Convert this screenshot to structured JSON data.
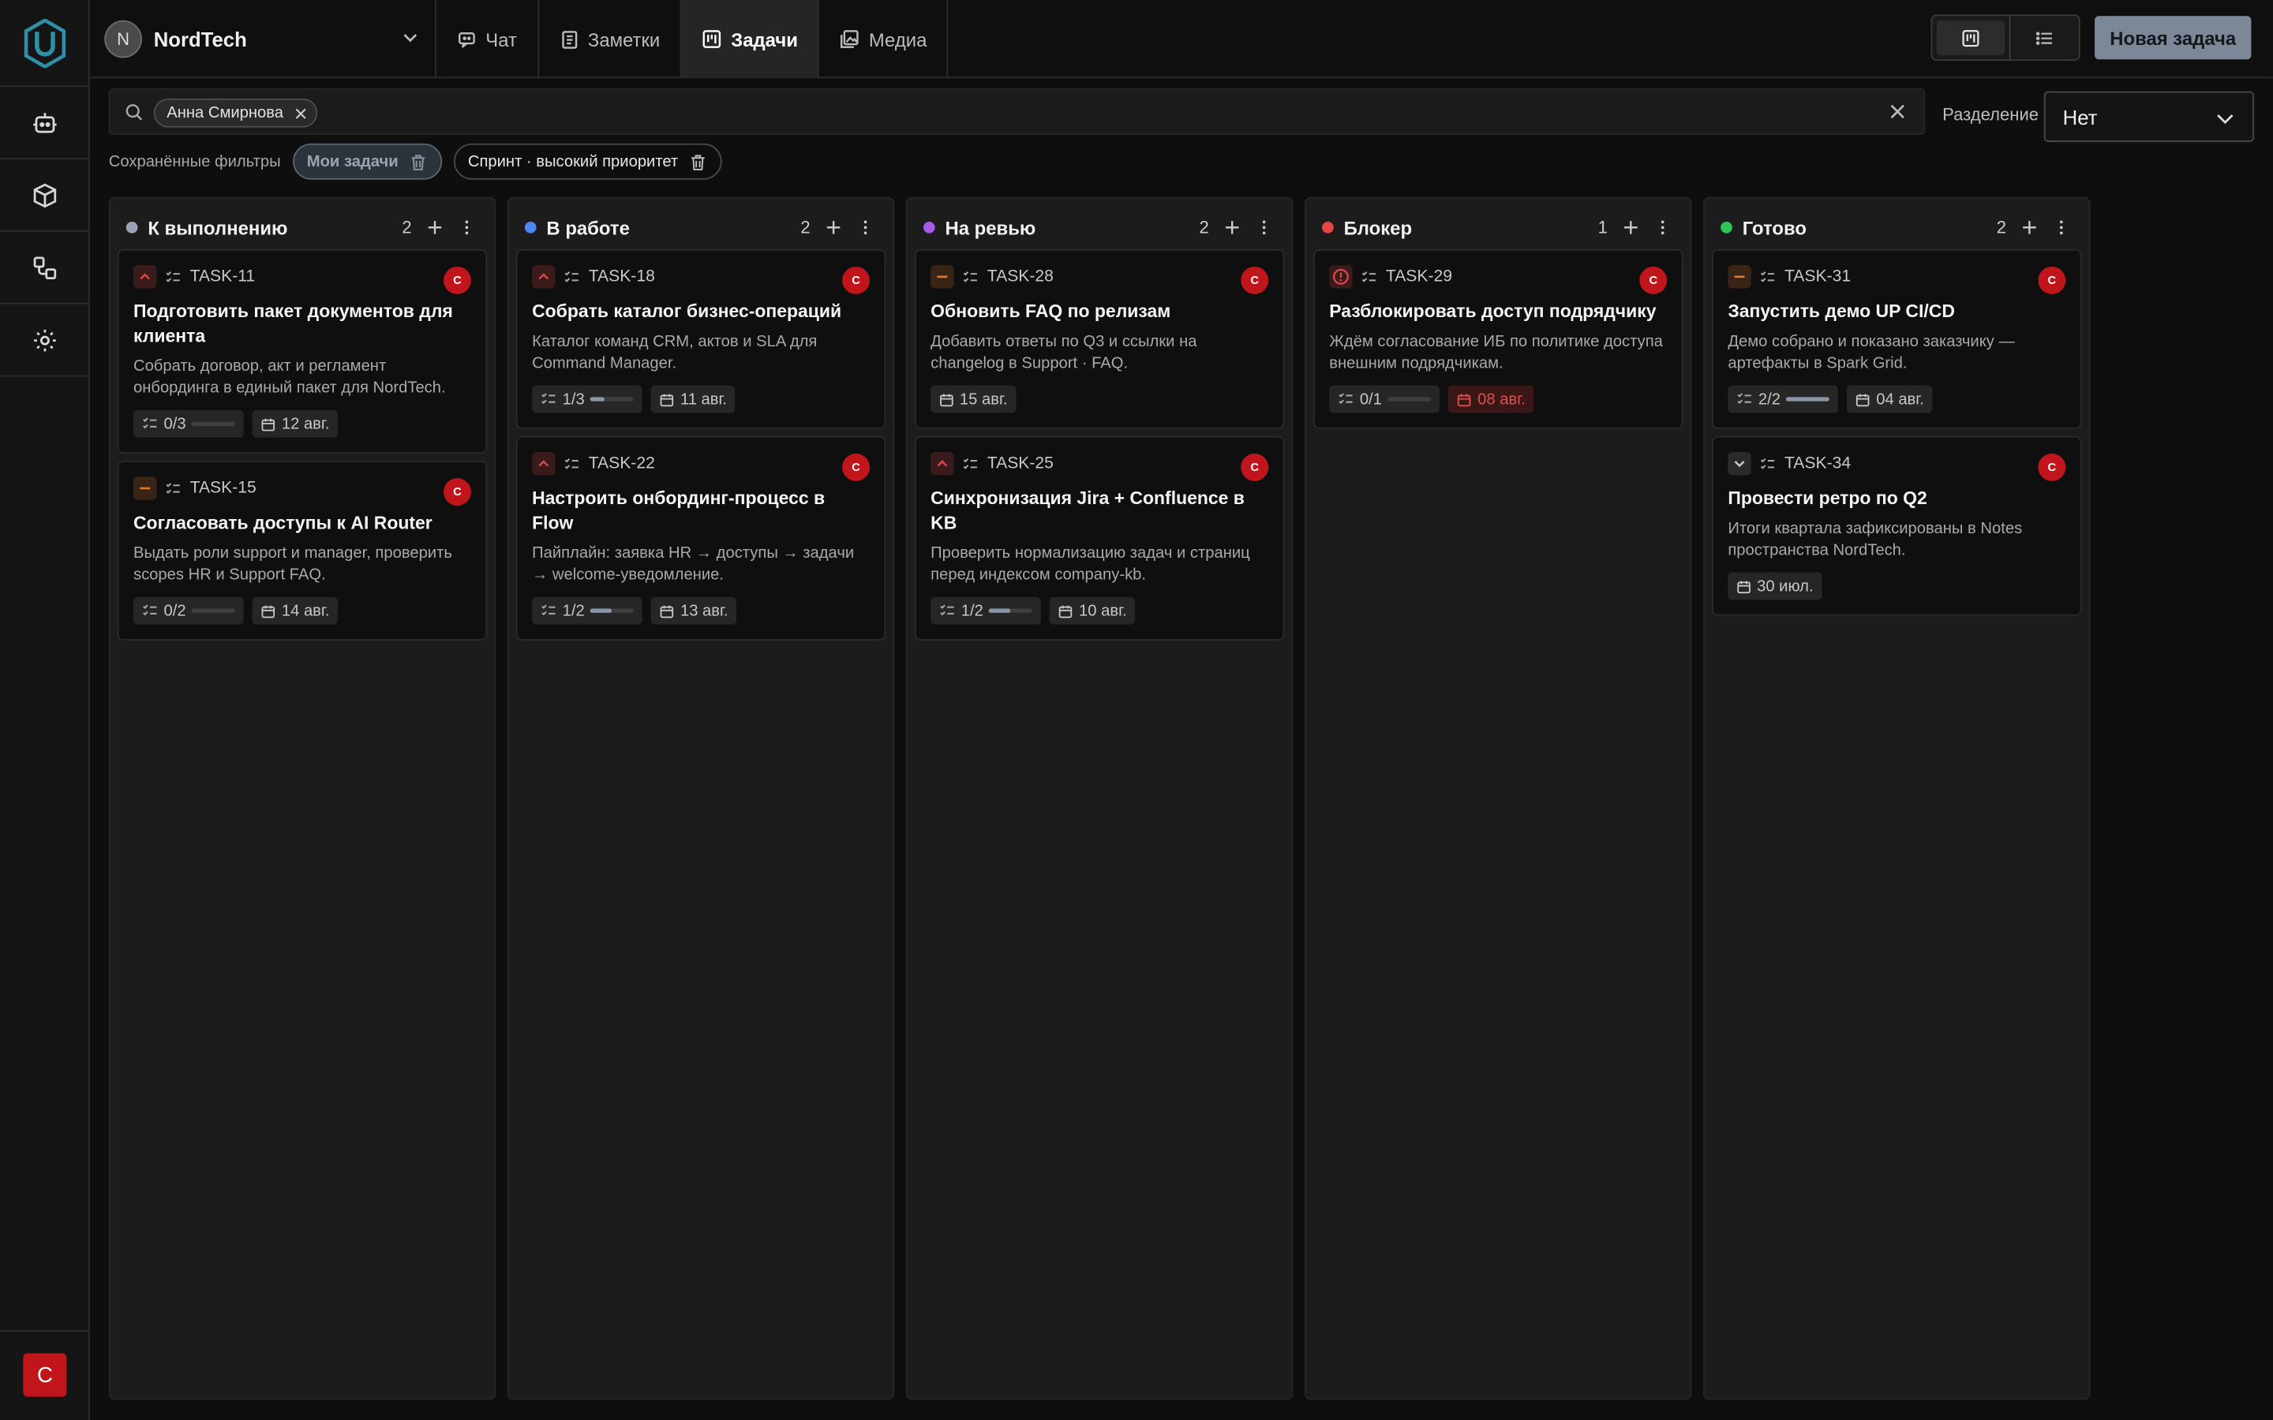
{
  "workspace": {
    "initial": "N",
    "name": "NordTech"
  },
  "nav": {
    "tabs": [
      {
        "label": "Чат",
        "icon": "chat-icon"
      },
      {
        "label": "Заметки",
        "icon": "notes-icon"
      },
      {
        "label": "Задачи",
        "icon": "board-icon",
        "active": true
      },
      {
        "label": "Медиа",
        "icon": "media-icon"
      }
    ]
  },
  "header": {
    "new_task": "Новая задача",
    "view": "board"
  },
  "user": {
    "initial": "C"
  },
  "search": {
    "chip": "Анна Смирнова"
  },
  "split": {
    "label": "Разделение",
    "value": "Нет"
  },
  "saved_filters": {
    "label": "Сохранённые фильтры",
    "items": [
      {
        "label": "Мои задачи",
        "active": true
      },
      {
        "label": "Спринт · высокий приоритет",
        "active": false
      }
    ]
  },
  "columns": [
    {
      "title": "К выполнению",
      "count": "2",
      "color": "#9aa3b5",
      "cards": [
        {
          "id": "TASK-11",
          "priority": "high",
          "title": "Подготовить пакет документов для клиента",
          "desc": "Собрать договор, акт и регламент онбординга в единый пакет для NordTech.",
          "progress": "0/3",
          "progress_frac": 0,
          "date": "12 авг.",
          "overdue": false,
          "assignee": "C"
        },
        {
          "id": "TASK-15",
          "priority": "medium",
          "title": "Согласовать доступы к AI Router",
          "desc": "Выдать роли support и manager, проверить scopes HR и Support FAQ.",
          "progress": "0/2",
          "progress_frac": 0,
          "date": "14 авг.",
          "overdue": false,
          "assignee": "C"
        }
      ]
    },
    {
      "title": "В работе",
      "count": "2",
      "color": "#4e86f0",
      "cards": [
        {
          "id": "TASK-18",
          "priority": "high",
          "title": "Собрать каталог бизнес-операций",
          "desc": "Каталог команд CRM, актов и SLA для Command Manager.",
          "progress": "1/3",
          "progress_frac": 0.333,
          "date": "11 авг.",
          "overdue": false,
          "assignee": "C"
        },
        {
          "id": "TASK-22",
          "priority": "high",
          "title": "Настроить онбординг-процесс в Flow",
          "desc": "Пайплайн: заявка HR → доступы → задачи → welcome-уведомление.",
          "progress": "1/2",
          "progress_frac": 0.5,
          "date": "13 авг.",
          "overdue": false,
          "assignee": "C"
        }
      ]
    },
    {
      "title": "На ревью",
      "count": "2",
      "color": "#a45be6",
      "cards": [
        {
          "id": "TASK-28",
          "priority": "medium",
          "title": "Обновить FAQ по релизам",
          "desc": "Добавить ответы по Q3 и ссылки на changelog в Support · FAQ.",
          "progress": "",
          "progress_frac": null,
          "date": "15 авг.",
          "overdue": false,
          "assignee": "C"
        },
        {
          "id": "TASK-25",
          "priority": "high",
          "title": "Синхронизация Jira + Confluence в KB",
          "desc": "Проверить нормализацию задач и страниц перед индексом company-kb.",
          "progress": "1/2",
          "progress_frac": 0.5,
          "date": "10 авг.",
          "overdue": false,
          "assignee": "C"
        }
      ]
    },
    {
      "title": "Блокер",
      "count": "1",
      "color": "#e54545",
      "cards": [
        {
          "id": "TASK-29",
          "priority": "urgent",
          "title": "Разблокировать доступ подрядчику",
          "desc": "Ждём согласование ИБ по политике доступа внешним подрядчикам.",
          "progress": "0/1",
          "progress_frac": 0,
          "date": "08 авг.",
          "overdue": true,
          "assignee": "C"
        }
      ]
    },
    {
      "title": "Готово",
      "count": "2",
      "color": "#2fc35a",
      "cards": [
        {
          "id": "TASK-31",
          "priority": "medium",
          "title": "Запустить демо UP CI/CD",
          "desc": "Демо собрано и показано заказчику — артефакты в Spark Grid.",
          "progress": "2/2",
          "progress_frac": 1,
          "date": "04 авг.",
          "overdue": false,
          "assignee": "C"
        },
        {
          "id": "TASK-34",
          "priority": "low",
          "title": "Провести ретро по Q2",
          "desc": "Итоги квартала зафиксированы в Notes пространства NordTech.",
          "progress": "",
          "progress_frac": null,
          "date": "30 июл.",
          "overdue": false,
          "assignee": "C"
        }
      ]
    }
  ]
}
